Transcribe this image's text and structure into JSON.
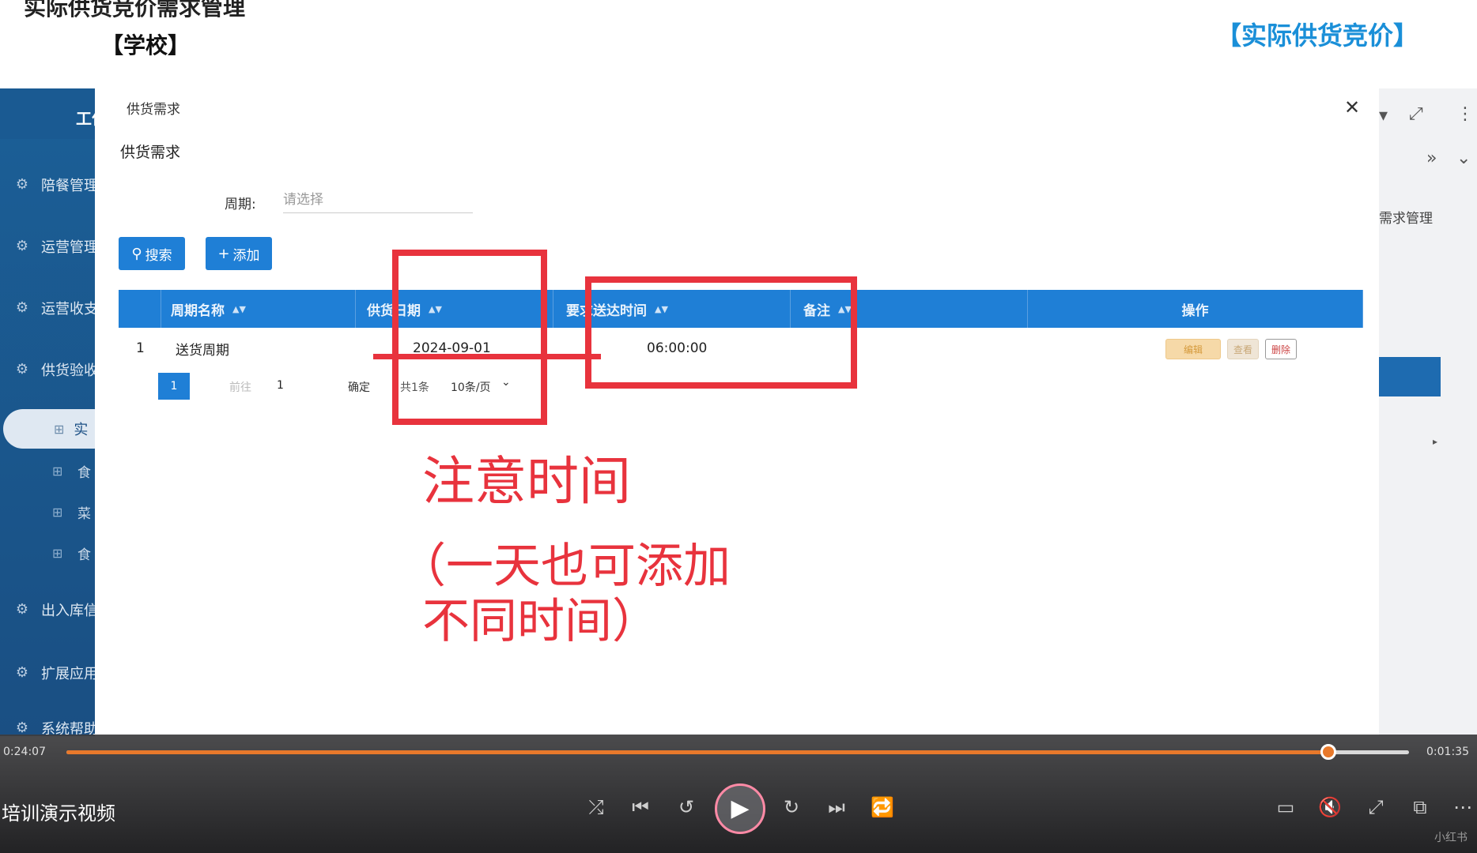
{
  "header": {
    "title": "实际供货竞价需求管理",
    "subtitle": "【学校】",
    "right_title": "【实际供货竞价】"
  },
  "sidebar": {
    "header": "工作",
    "items": [
      {
        "label": "陪餐管理",
        "icon": "gear-icon"
      },
      {
        "label": "运营管理",
        "icon": "gear-icon"
      },
      {
        "label": "运营收支",
        "icon": "gear-icon"
      },
      {
        "label": "供货验收",
        "icon": "gear-icon"
      },
      {
        "label": "出入库信",
        "icon": "gear-icon"
      },
      {
        "label": "扩展应用",
        "icon": "gear-icon"
      },
      {
        "label": "系统帮助",
        "icon": "gear-icon"
      }
    ],
    "active_item": "实",
    "sub_items": [
      "食",
      "菜",
      "食"
    ]
  },
  "right_panel": {
    "tab_label": "需求管理"
  },
  "dialog": {
    "title": "供货需求",
    "section_title": "供货需求",
    "filter": {
      "label": "周期:",
      "placeholder": "请选择"
    },
    "buttons": {
      "search": "搜索",
      "add": "添加"
    },
    "table": {
      "columns": [
        "周期名称",
        "供货日期",
        "要求送达时间",
        "备注",
        "操作"
      ],
      "rows": [
        {
          "index": "1",
          "period_name": "送货周期",
          "supply_date": "2024-09-01",
          "delivery_time": "06:00:00",
          "remark": "",
          "actions": {
            "edit": "编辑",
            "view": "查看",
            "delete": "删除"
          }
        }
      ]
    },
    "pagination": {
      "current_page": "1",
      "goto_label": "前往",
      "goto_value": "1",
      "confirm": "确定",
      "total": "共1条",
      "page_size": "10条/页"
    }
  },
  "annotation": {
    "main": "注意时间",
    "note_line1": "（一天也可添加",
    "note_line2": "不同时间）",
    "color": "#e8333d"
  },
  "player": {
    "elapsed": "0:24:07",
    "remaining": "0:01:35",
    "progress_fraction": 0.94,
    "video_title": "培训演示视频",
    "watermark": "小红书",
    "accent_color": "#e8792b"
  }
}
